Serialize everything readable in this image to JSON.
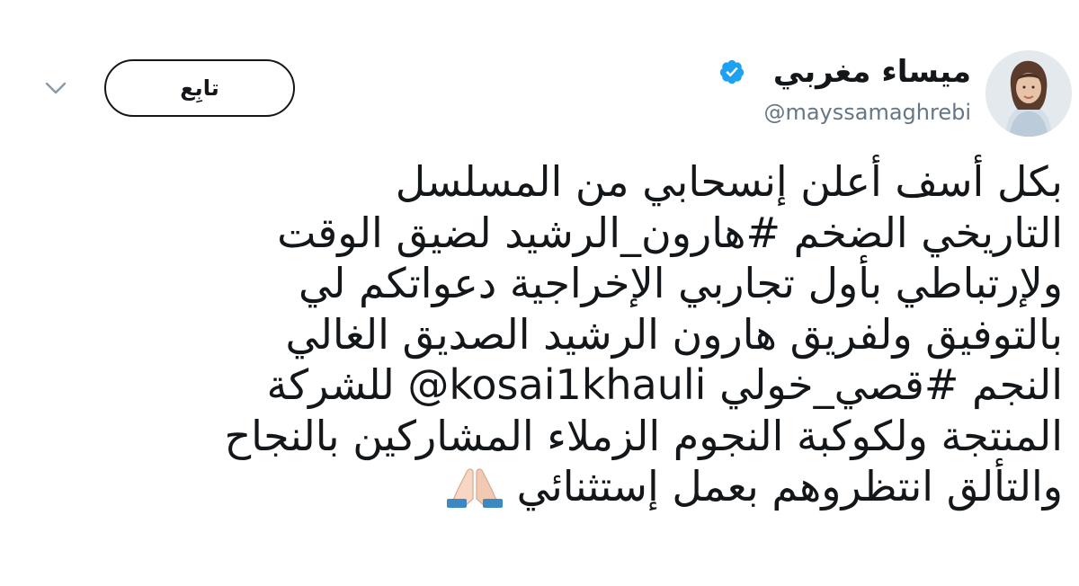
{
  "tweet": {
    "author": {
      "display_name": "ميساء مغربي",
      "handle": "@mayssamaghrebi",
      "verified_icon": "verified-badge-icon",
      "avatar": "avatar"
    },
    "follow_button": {
      "label": "تابِع"
    },
    "menu_icon": "chevron-down-icon",
    "text": {
      "line1": "بكل أسف أعلن إنسحابي من المسلسل",
      "line2_a": "التاريخي الضخم ",
      "line2_hashtag": "#هارون_الرشيد",
      "line2_b": " لضيق الوقت",
      "line3": "ولإرتباطي بأول تجاربي الإخراجية دعواتكم لي",
      "line4": "بالتوفيق ولفريق هارون الرشيد الصديق الغالي",
      "line5_a": "النجم ",
      "line5_hashtag": "#قصي_خولي",
      "line5_mention": "@kosai1khauli",
      "line5_b": " للشركة",
      "line6": "المنتجة ولكوكبة النجوم الزملاء المشاركين بالنجاح",
      "line7": "والتألق انتظروهم بعمل إستثنائي",
      "emoji": "folded-hands-icon"
    }
  },
  "colors": {
    "verified_blue": "#1da1f2",
    "text": "#14171a",
    "secondary": "#657786"
  }
}
